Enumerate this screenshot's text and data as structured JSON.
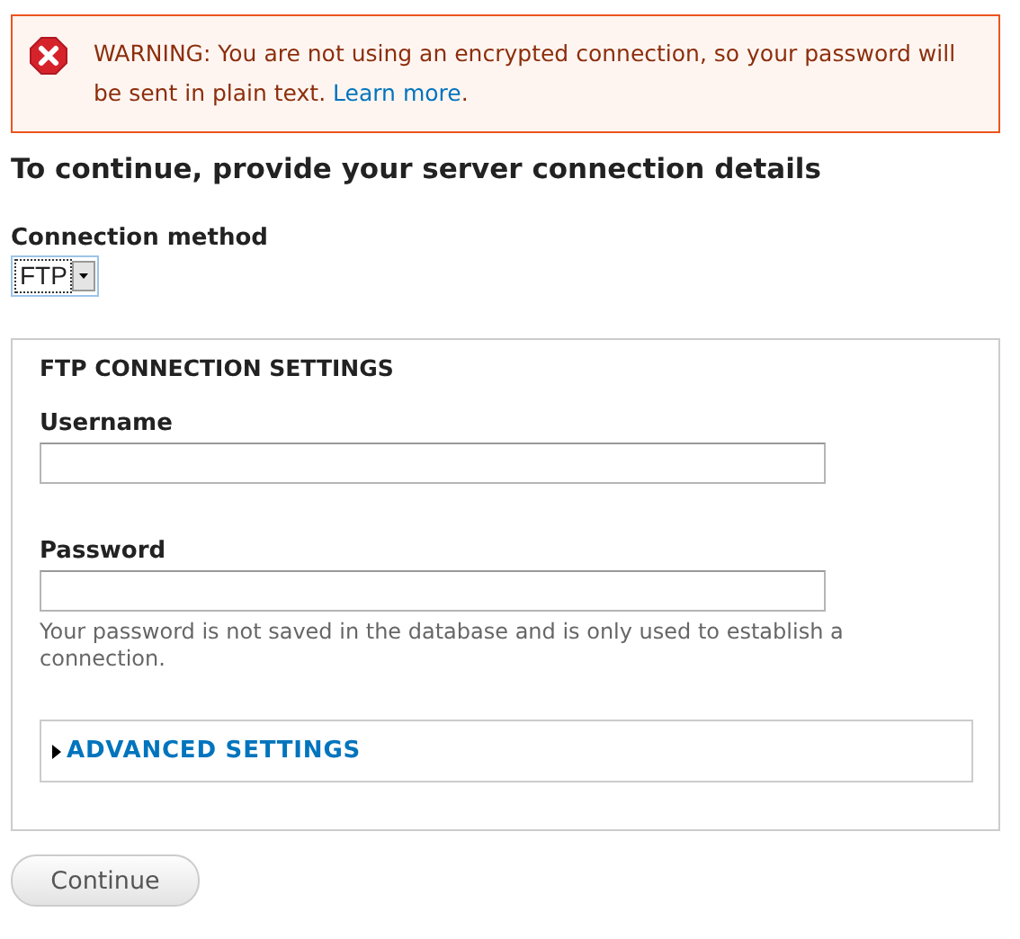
{
  "warning": {
    "message": "WARNING: You are not using an encrypted connection, so your password will be sent in plain text.",
    "link": "Learn more",
    "trailing": "."
  },
  "heading": "To continue, provide your server connection details",
  "connection_method": {
    "label": "Connection method",
    "value": "FTP"
  },
  "fieldset": {
    "legend": "FTP CONNECTION SETTINGS",
    "fields": [
      {
        "label": "Username"
      },
      {
        "label": "Password",
        "description": "Your password is not saved in the database and is only used to establish a connection."
      }
    ],
    "advanced": {
      "label": "ADVANCED SETTINGS",
      "expanded": false
    }
  },
  "buttons": [
    "Continue"
  ]
}
